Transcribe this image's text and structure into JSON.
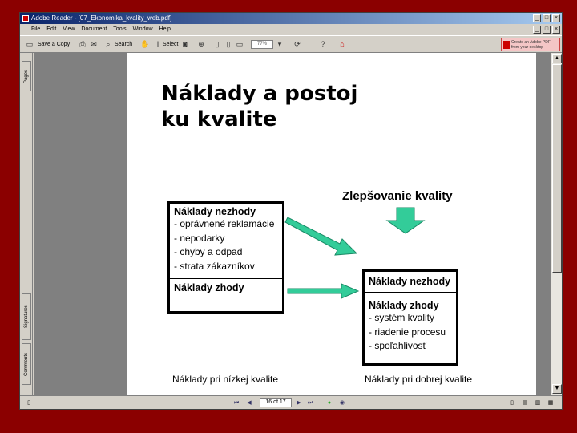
{
  "window": {
    "title": "Adobe Reader - [07_Ekonomika_kvality_web.pdf]",
    "min": "_",
    "max": "□",
    "close": "×"
  },
  "menu": [
    "File",
    "Edit",
    "View",
    "Document",
    "Tools",
    "Window",
    "Help"
  ],
  "toolbar": {
    "save_copy": "Save a Copy",
    "search": "Search",
    "select": "Select",
    "zoom": "77%",
    "adobe_banner": "Create an Adobe PDF from your desktop"
  },
  "left_panel": {
    "pages_tab": "Pages",
    "signatures_tab": "Signatures",
    "comments_tab": "Comments"
  },
  "slide": {
    "title_line1": "Náklady a postoj",
    "title_line2": "ku kvalite",
    "improvement_label": "Zlepšovanie kvality",
    "low_box": {
      "nonconformance_head": "Náklady nezhody",
      "items": [
        "- oprávnené reklamácie",
        "- nepodarky",
        "- chyby a odpad",
        "- strata zákazníkov"
      ],
      "conformance_head": "Náklady zhody"
    },
    "high_box": {
      "nonconformance_head": "Náklady nezhody",
      "conformance_head": "Náklady zhody",
      "items": [
        "- systém kvality",
        "- riadenie procesu",
        "- spoľahlivosť"
      ]
    },
    "caption_low": "Náklady pri nízkej kvalite",
    "caption_high": "Náklady pri dobrej kvalite"
  },
  "statusbar": {
    "page_indicator": "16 of 17"
  },
  "colors": {
    "background": "#8b0000",
    "arrow": "#33cc99",
    "titlebar": "#0a246a"
  }
}
